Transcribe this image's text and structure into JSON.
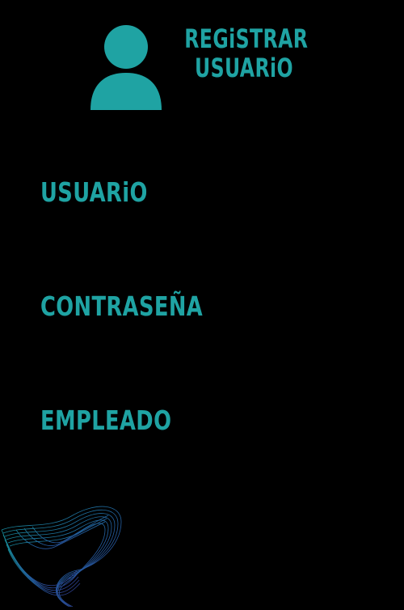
{
  "header": {
    "title_line1": "REGiSTRAR",
    "title_line2": "USUARiO",
    "avatar_icon": "user-icon"
  },
  "form": {
    "usuario_label": "USUARiO",
    "contrasena_label": "CONTRASEÑA",
    "empleado_label": "EMPLEADO"
  },
  "colors": {
    "accent": "#1fa3a3",
    "background": "#000000"
  },
  "decor": {
    "wave_icon": "abstract-wave-icon"
  }
}
